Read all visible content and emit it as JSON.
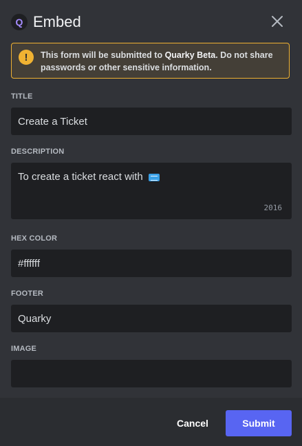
{
  "header": {
    "app_icon_letter": "Q",
    "title": "Embed",
    "close_icon": "close-icon"
  },
  "warning": {
    "prefix": "This form will be submitted to ",
    "app_name": "Quarky Beta",
    "suffix": ". Do not share passwords or other sensitive information.",
    "icon": "exclamation-icon"
  },
  "fields": {
    "title": {
      "label": "TITLE",
      "value": "Create a Ticket"
    },
    "description": {
      "label": "DESCRIPTION",
      "value": "To create a ticket react with",
      "emoji": "ticket-emoji",
      "char_count": "2016"
    },
    "hex_color": {
      "label": "HEX COLOR",
      "value": "#ffffff"
    },
    "footer": {
      "label": "FOOTER",
      "value": "Quarky"
    },
    "image": {
      "label": "IMAGE",
      "value": ""
    }
  },
  "actions": {
    "cancel_label": "Cancel",
    "submit_label": "Submit"
  },
  "colors": {
    "accent": "#5865f2",
    "warning": "#f0b232",
    "background": "#313338",
    "input_bg": "#1e1f22",
    "footer_bg": "#2b2d31"
  }
}
